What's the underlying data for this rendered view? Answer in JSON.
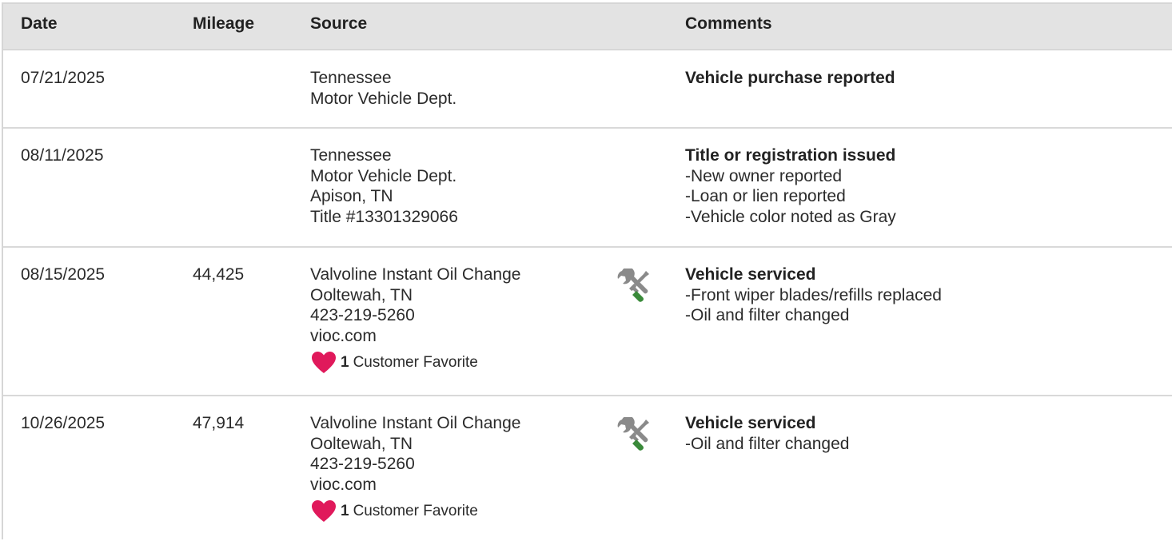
{
  "table": {
    "headers": {
      "date": "Date",
      "mileage": "Mileage",
      "source": "Source",
      "comments": "Comments"
    },
    "rows": [
      {
        "date": "07/21/2025",
        "mileage": "",
        "source": [
          "Tennessee",
          "Motor Vehicle Dept."
        ],
        "comment_title": "Vehicle purchase reported",
        "comment_items": []
      },
      {
        "date": "08/11/2025",
        "mileage": "",
        "source": [
          "Tennessee",
          "Motor Vehicle Dept.",
          "Apison, TN",
          "Title #13301329066"
        ],
        "comment_title": "Title or registration issued",
        "comment_items": [
          "-New owner reported",
          "-Loan or lien reported",
          "-Vehicle color noted as Gray"
        ]
      },
      {
        "date": "08/15/2025",
        "mileage": "44,425",
        "source": [
          "Valvoline Instant Oil Change",
          "Ooltewah, TN",
          "423-219-5260",
          "vioc.com"
        ],
        "favorite_count": "1",
        "favorite_label": "Customer Favorite",
        "icon": "service-tools-icon",
        "comment_title": "Vehicle serviced",
        "comment_items": [
          "-Front wiper blades/refills replaced",
          "-Oil and filter changed"
        ]
      },
      {
        "date": "10/26/2025",
        "mileage": "47,914",
        "source": [
          "Valvoline Instant Oil Change",
          "Ooltewah, TN",
          "423-219-5260",
          "vioc.com"
        ],
        "favorite_count": "1",
        "favorite_label": "Customer Favorite",
        "icon": "service-tools-icon",
        "comment_title": "Vehicle serviced",
        "comment_items": [
          "-Oil and filter changed"
        ]
      }
    ]
  },
  "colors": {
    "header_bg": "#e3e3e3",
    "heart": "#e0195b",
    "wrench_gray": "#8a8a8a",
    "screwdriver_green": "#3a8a3a"
  }
}
